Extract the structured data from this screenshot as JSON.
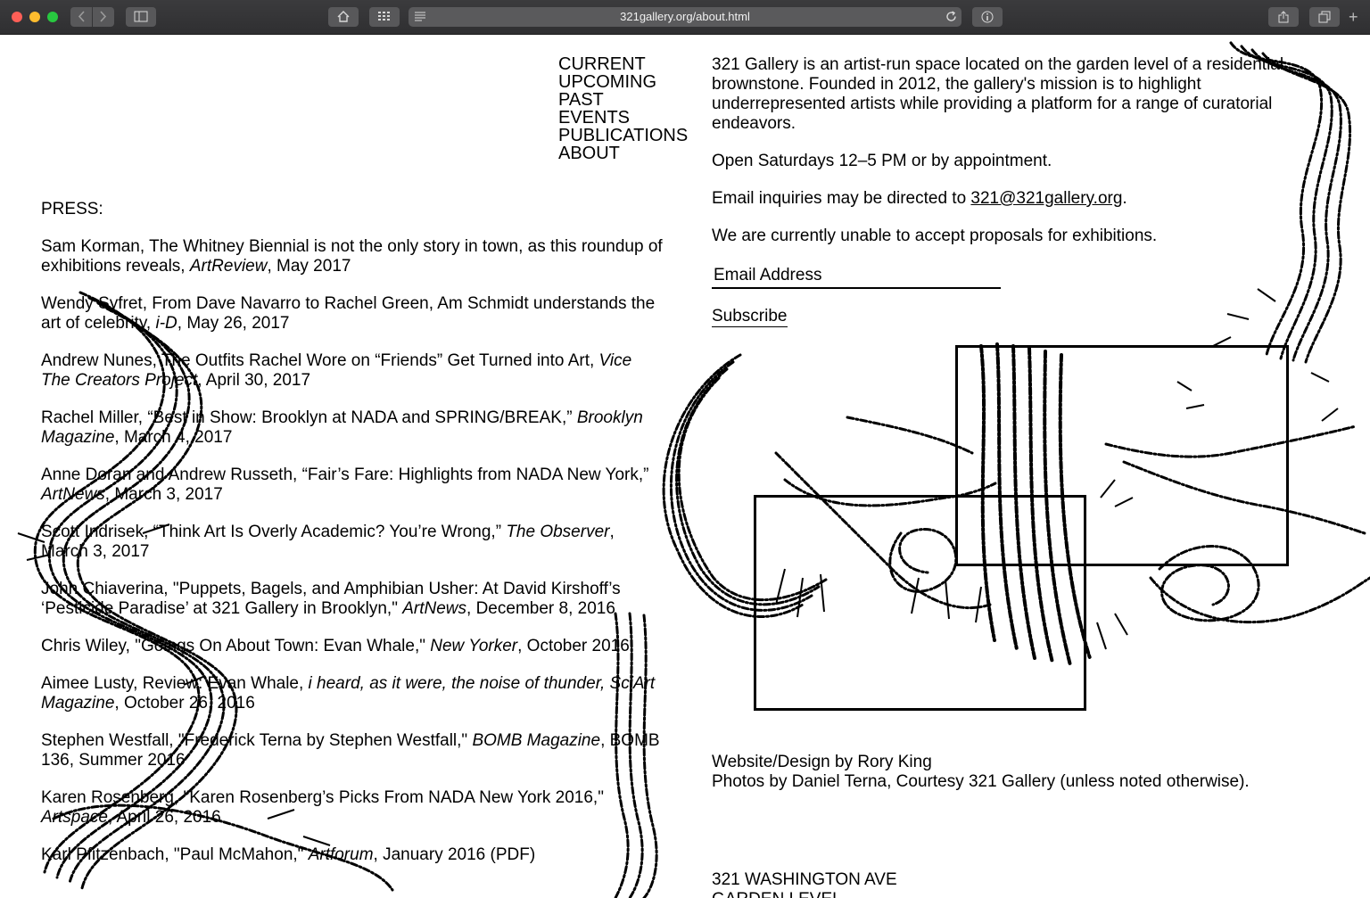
{
  "browser": {
    "url": "321gallery.org/about.html"
  },
  "nav": {
    "items": [
      "CURRENT",
      "UPCOMING",
      "PAST",
      "EVENTS",
      "PUBLICATIONS",
      "ABOUT"
    ]
  },
  "about": {
    "intro": "321 Gallery is an artist-run space located on the garden level of a residential brownstone. Founded in 2012, the gallery's mission is to highlight underrepresented artists while providing a platform for a range of curatorial endeavors.",
    "hours": "Open Saturdays 12–5 PM or by appointment.",
    "email_prefix": "Email inquiries may be directed to ",
    "email": "321@321gallery.org",
    "email_suffix": ".",
    "proposals": "We are currently unable to accept proposals for exhibitions.",
    "newsletter_placeholder": "Email Address",
    "subscribe_label": "Subscribe",
    "credit_design": "Website/Design by Rory King",
    "credit_photos": "Photos by Daniel Terna, Courtesy 321 Gallery (unless noted otherwise).",
    "address_line1": "321 WASHINGTON AVE",
    "address_line2": "GARDEN LEVEL"
  },
  "press": {
    "heading": "PRESS:",
    "items": [
      {
        "pre": "Sam Korman, The Whitney Biennial is not the only story in town, as this roundup of exhibitions reveals, ",
        "pub": "ArtReview",
        "post": ", May 2017"
      },
      {
        "pre": "Wendy Syfret, From Dave Navarro to Rachel Green, Am Schmidt understands the art of celebrity, ",
        "pub": "i-D",
        "post": ", May 26, 2017"
      },
      {
        "pre": "Andrew Nunes, The Outfits Rachel Wore on “Friends” Get Turned into Art, ",
        "pub": "Vice The Creators Project",
        "post": ", April 30, 2017"
      },
      {
        "pre": "Rachel Miller, “Best in Show: Brooklyn at NADA and SPRING/BREAK,” ",
        "pub": "Brooklyn Magazine",
        "post": ", March 4, 2017"
      },
      {
        "pre": "Anne Doran and Andrew Russeth, “Fair’s Fare: Highlights from NADA New York,” ",
        "pub": "ArtNews",
        "post": ", March 3, 2017"
      },
      {
        "pre": "Scott Indrisek, “Think Art Is Overly Academic? You’re Wrong,” ",
        "pub": "The Observer",
        "post": ", March 3, 2017"
      },
      {
        "pre": "John Chiaverina, \"Puppets, Bagels, and Amphibian Usher: At David Kirshoff’s ‘Pesticide Paradise’ at 321 Gallery in Brooklyn,\" ",
        "pub": "ArtNews",
        "post": ", December 8, 2016"
      },
      {
        "pre": "Chris Wiley, \"Goings On About Town: Evan Whale,\" ",
        "pub": "New Yorker",
        "post": ", October 2016"
      },
      {
        "pre": "Aimee Lusty, Review: Evan Whale, ",
        "pub": "i heard, as it were, the noise of thunder, SciArt Magazine",
        "post": ", October 26, 2016"
      },
      {
        "pre": "Stephen Westfall, \"Frederick Terna by Stephen Westfall,\" ",
        "pub": "BOMB Magazine",
        "post": ", BOMB 136, Summer 2016"
      },
      {
        "pre": "Karen Rosenberg, \"Karen Rosenberg’s Picks From NADA New York 2016,\" ",
        "pub": "Artspace",
        "post": ", April 26, 2016"
      },
      {
        "pre": "Karl Pfitzenbach, \"Paul McMahon,\" ",
        "pub": "Artforum",
        "post": ", January 2016 (PDF)"
      }
    ]
  }
}
